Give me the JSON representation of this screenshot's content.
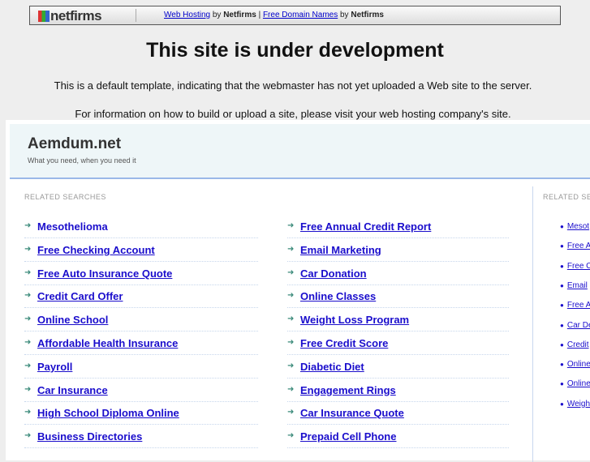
{
  "topbar": {
    "logo_text": "netfirms",
    "link1": "Web Hosting",
    "by": "by",
    "brand": "Netfirms",
    "divider": "|",
    "link2": "Free Domain Names"
  },
  "title": "This site is under development",
  "para1": "This is a default template, indicating that the webmaster has not yet uploaded a Web site to the server.",
  "para2": "For information on how to build or upload a site, please visit your web hosting company's site.",
  "site": {
    "name": "Aemdum.net",
    "tagline": "What you need, when you need it"
  },
  "related_label": "RELATED SEARCHES",
  "side_label": "RELATED SE",
  "left_links": [
    "Mesothelioma",
    "Free Checking Account",
    "Free Auto Insurance Quote",
    "Credit Card Offer",
    "Online School",
    "Affordable Health Insurance",
    "Payroll",
    "Car Insurance",
    "High School Diploma Online",
    "Business Directories"
  ],
  "right_links": [
    "Free Annual Credit Report",
    "Email Marketing",
    "Car Donation",
    "Online Classes",
    "Weight Loss Program",
    "Free Credit Score",
    "Diabetic Diet",
    "Engagement Rings",
    "Car Insurance Quote",
    "Prepaid Cell Phone"
  ],
  "side_links": [
    "Mesot",
    "Free A",
    "Free C",
    "Email",
    "Free A",
    "Car De",
    "Credit",
    "Online",
    "Online",
    "Weigh"
  ]
}
